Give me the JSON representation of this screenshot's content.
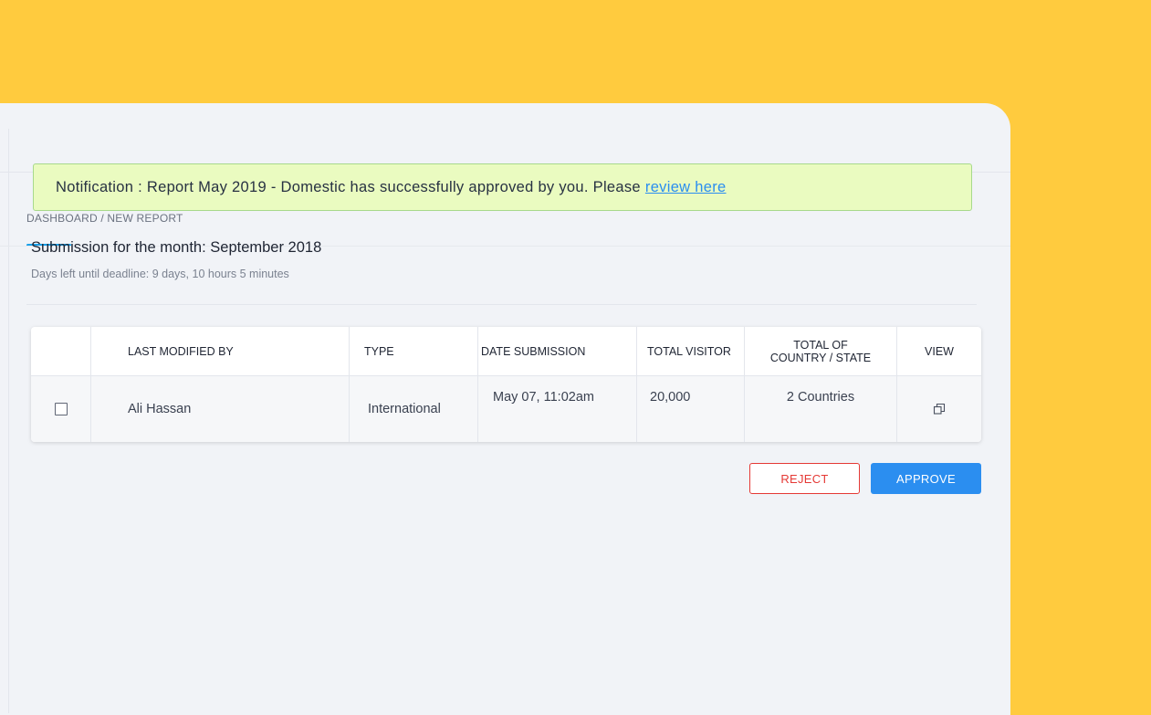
{
  "breadcrumb": "DASHBOARD / NEW REPORT",
  "notification": {
    "text": "Notification : Report May 2019 - Domestic has successfully approved by you.  Please",
    "link": "review here"
  },
  "submission": {
    "title": "Submission for the month: September 2018",
    "deadline": "Days left until deadline: 9 days, 10 hours 5 minutes"
  },
  "table": {
    "headers": {
      "last_modified_by": "LAST MODIFIED BY",
      "type": "TYPE",
      "date_submission": "DATE SUBMISSION",
      "total_visitor": "TOTAL VISITOR",
      "total_country_line1": "TOTAL OF",
      "total_country_line2": "COUNTRY / STATE",
      "view": "VIEW"
    },
    "rows": [
      {
        "checked": false,
        "last_modified_by": "Ali Hassan",
        "type": "International",
        "date_submission": "May 07, 11:02am",
        "total_visitor": "20,000",
        "total_country": "2 Countries",
        "view_icon": "open-window-icon"
      }
    ]
  },
  "actions": {
    "reject": "REJECT",
    "approve": "APPROVE"
  },
  "colors": {
    "background": "#FFCB3E",
    "panel": "#F1F3F7",
    "accent": "#1AA0E8",
    "notification_bg": "#EAFBC0",
    "link": "#2B8EF0",
    "reject": "#E53935",
    "approve": "#2B8EF0"
  }
}
